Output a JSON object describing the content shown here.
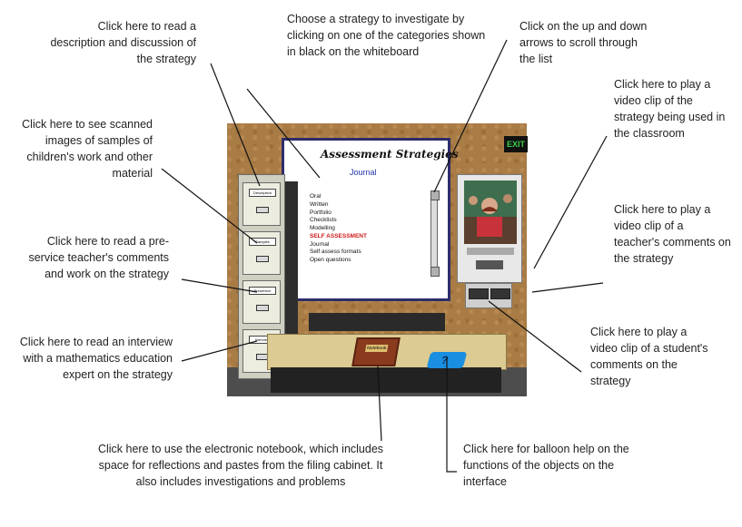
{
  "callouts": {
    "description": "Click here to read a description and discussion of the strategy",
    "scanned_images": "Click here to see scanned images of samples of children's work and other material",
    "preservice": "Click here to read a pre-service teacher's comments and work on the strategy",
    "interview": "Click here to read an interview with a mathematics education expert on the strategy",
    "choose_strategy": "Choose a strategy to investigate by clicking on one of the categories shown in black on the whiteboard",
    "scroll": "Click on the up and down arrows to scroll through the list",
    "play_video": "Click here to play a video clip of the strategy being used in the classroom",
    "teacher_comments": "Click here to play a video clip of a teacher's comments on the strategy",
    "student_comments": "Click here to play a video clip of a student's comments on the strategy",
    "notebook": "Click here to use the electronic notebook, which includes space for reflections and pastes from the filing cabinet. It also includes investigations and problems",
    "balloon_help": "Click here for balloon help on the functions of the objects on the interface"
  },
  "scene": {
    "whiteboard_title": "Assessment Strategies",
    "whiteboard_subtitle": "Journal",
    "strategy_list": [
      "Oral",
      "Written",
      "Portfolio",
      "Checklists",
      "Modelling"
    ],
    "highlighted": "SELF ASSESSMENT",
    "strategy_list_2": [
      "Journal",
      "Self assess formats",
      "Open questions"
    ],
    "exit_label": "EXIT",
    "drawer_labels": [
      "Description",
      "Samples",
      "Preservice",
      "Interview"
    ],
    "notebook_label": "Notebook",
    "help_symbol": "?"
  }
}
